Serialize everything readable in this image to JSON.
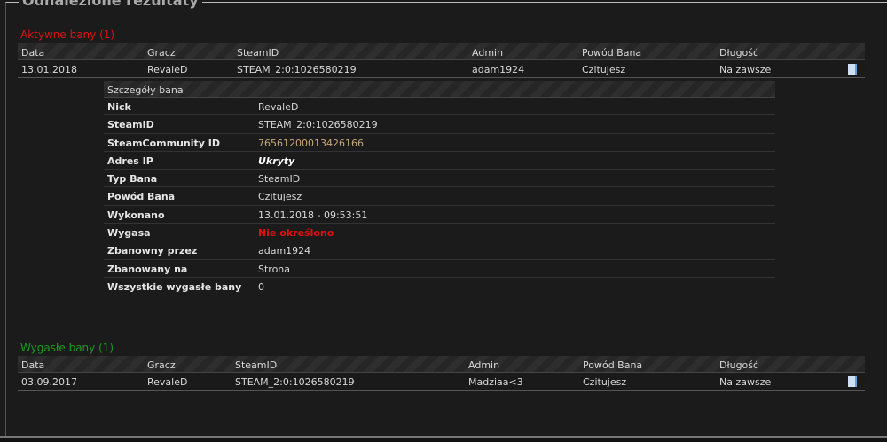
{
  "title": "Odnalezione rezultaty",
  "active": {
    "label": "Aktywne bany (1)",
    "color": "#e01010",
    "headers": [
      "Data",
      "Gracz",
      "SteamID",
      "Admin",
      "Powód Bana",
      "Długość"
    ],
    "rows": [
      [
        "13.01.2018",
        "RevaleD",
        "STEAM_2:0:1026580219",
        "adam1924",
        "Czitujesz",
        "Na zawsze"
      ]
    ]
  },
  "details": {
    "title": "Szczegóły bana",
    "rows": [
      {
        "k": "Nick",
        "v": "RevaleD"
      },
      {
        "k": "SteamID",
        "v": "STEAM_2:0:1026580219"
      },
      {
        "k": "SteamCommunity ID",
        "v": "76561200013426166"
      },
      {
        "k": "Adres IP",
        "v": "Ukryty"
      },
      {
        "k": "Typ Bana",
        "v": "SteamID"
      },
      {
        "k": "Powód Bana",
        "v": "Czitujesz"
      },
      {
        "k": "Wykonano",
        "v": "13.01.2018 - 09:53:51"
      },
      {
        "k": "Wygasa",
        "v": "Nie określono"
      },
      {
        "k": "Zbanowny przez",
        "v": "adam1924"
      },
      {
        "k": "Zbanowany na",
        "v": "Strona"
      },
      {
        "k": "Wszystkie wygasłe bany",
        "v": "0"
      }
    ]
  },
  "expired": {
    "label": "Wygasłe bany (1)",
    "color": "#1e9a1e",
    "headers": [
      "Data",
      "Gracz",
      "SteamID",
      "Admin",
      "Powód Bana",
      "Długość"
    ],
    "rows": [
      [
        "03.09.2017",
        "RevaleD",
        "STEAM_2:0:1026580219",
        "Madziaa<3",
        "Czitujesz",
        "Na zawsze"
      ]
    ]
  },
  "icons": {
    "details": "document-icon"
  }
}
